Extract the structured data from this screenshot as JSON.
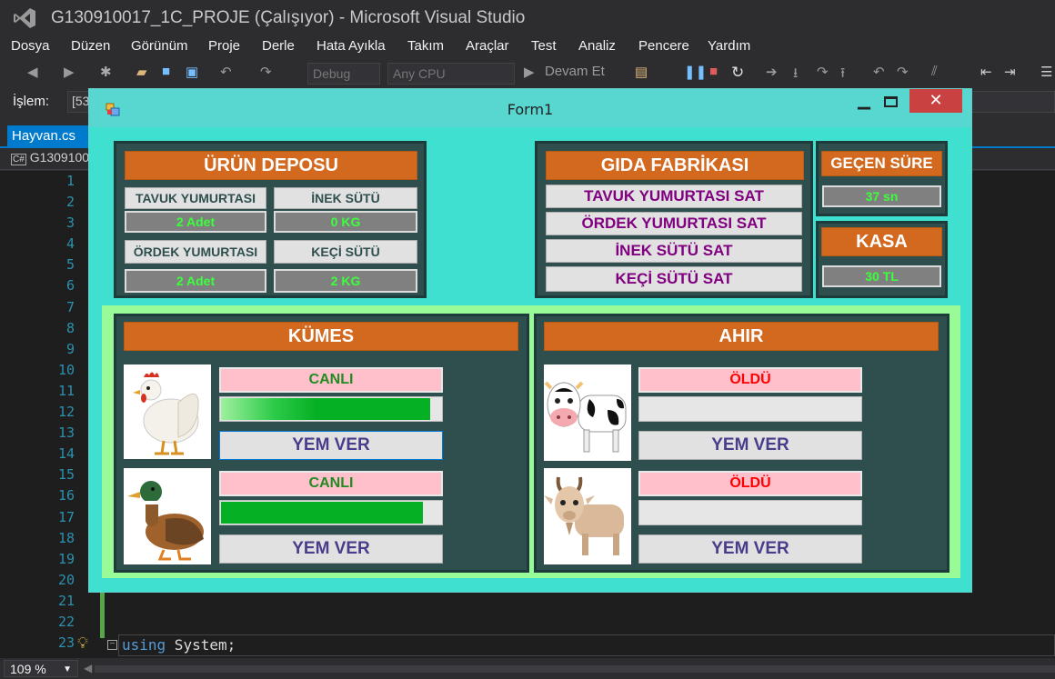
{
  "vs": {
    "title": "G130910017_1C_PROJE (Çalışıyor) - Microsoft Visual Studio",
    "menu": [
      "Dosya",
      "Düzen",
      "Görünüm",
      "Proje",
      "Derle",
      "Hata Ayıkla",
      "Takım",
      "Araçlar",
      "Test",
      "Analiz",
      "Pencere",
      "Yardım"
    ],
    "config": "Debug",
    "platform": "Any CPU",
    "continue_label": "Devam Et",
    "islem_label": "İşlem:",
    "islem_value": "[53",
    "doc_tab": "Hayvan.cs",
    "nav_combo": "G1309100",
    "line_numbers": [
      "1",
      "2",
      "3",
      "4",
      "5",
      "6",
      "7",
      "8",
      "9",
      "10",
      "11",
      "12",
      "13",
      "14",
      "15",
      "16",
      "17",
      "18",
      "19",
      "20",
      "21",
      "22",
      "23"
    ],
    "code_keyword": "using",
    "code_rest": " System;",
    "zoom": "109 %"
  },
  "form": {
    "title": "Form1",
    "depo": {
      "title": "ÜRÜN DEPOSU",
      "tavuk_label": "TAVUK YUMURTASI",
      "tavuk_value": "2 Adet",
      "inek_label": "İNEK SÜTÜ",
      "inek_value": "0 KG",
      "ordek_label": "ÖRDEK YUMURTASI",
      "ordek_value": "2 Adet",
      "keci_label": "KEÇİ SÜTÜ",
      "keci_value": "2 KG"
    },
    "fabrika": {
      "title": "GIDA FABRİKASI",
      "buttons": [
        "TAVUK YUMURTASI SAT",
        "ÖRDEK YUMURTASI SAT",
        "İNEK SÜTÜ SAT",
        "KEÇİ SÜTÜ SAT"
      ]
    },
    "sure": {
      "title": "GEÇEN SÜRE",
      "value": "37 sn"
    },
    "kasa": {
      "title": "KASA",
      "value": "30 TL"
    },
    "kumes": {
      "title": "KÜMES",
      "animals": [
        {
          "status": "CANLI",
          "status_color": "#228b22",
          "level": 0.95,
          "feed": "YEM VER"
        },
        {
          "status": "CANLI",
          "status_color": "#228b22",
          "level": 0.92,
          "feed": "YEM VER"
        }
      ]
    },
    "ahir": {
      "title": "AHIR",
      "animals": [
        {
          "status": "ÖLDÜ",
          "status_color": "#ff0000",
          "level": 0,
          "feed": "YEM VER"
        },
        {
          "status": "ÖLDÜ",
          "status_color": "#ff0000",
          "level": 0,
          "feed": "YEM VER"
        }
      ]
    }
  }
}
